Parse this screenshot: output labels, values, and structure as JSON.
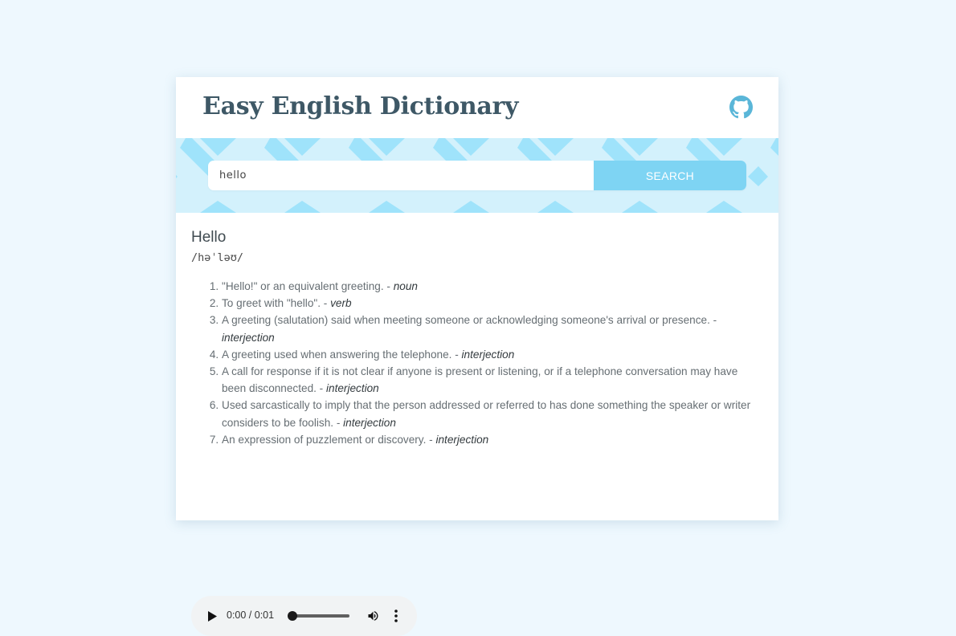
{
  "header": {
    "title": "Easy English Dictionary",
    "github_icon": "github-icon"
  },
  "search": {
    "value": "hello",
    "button_label": "SEARCH"
  },
  "result": {
    "word": "Hello",
    "phonetic": "/həˈləʊ/",
    "meanings": [
      {
        "definition": "\"Hello!\" or an equivalent greeting.",
        "separator": " - ",
        "part_of_speech": "noun"
      },
      {
        "definition": "To greet with \"hello\".",
        "separator": " - ",
        "part_of_speech": "verb"
      },
      {
        "definition": "A greeting (salutation) said when meeting someone or acknowledging someone's arrival or presence.",
        "separator": " - ",
        "part_of_speech": "interjection"
      },
      {
        "definition": "A greeting used when answering the telephone.",
        "separator": " - ",
        "part_of_speech": "interjection"
      },
      {
        "definition": "A call for response if it is not clear if anyone is present or listening, or if a telephone conversation may have been disconnected.",
        "separator": " - ",
        "part_of_speech": "interjection"
      },
      {
        "definition": "Used sarcastically to imply that the person addressed or referred to has done something the speaker or writer considers to be foolish.",
        "separator": " - ",
        "part_of_speech": "interjection"
      },
      {
        "definition": "An expression of puzzlement or discovery.",
        "separator": " - ",
        "part_of_speech": "interjection"
      }
    ]
  },
  "audio_player": {
    "time": "0:00 / 0:01",
    "progress": 0,
    "icons": [
      "play-icon",
      "volume-icon",
      "more-options-icon"
    ]
  },
  "colors": {
    "background": "#eef8fe",
    "title": "#3e5866",
    "accent": "#7ed4f3",
    "banner_light": "#d3f1fc",
    "banner_pattern": "#9fe3fb",
    "github": "#5ab6d8"
  }
}
